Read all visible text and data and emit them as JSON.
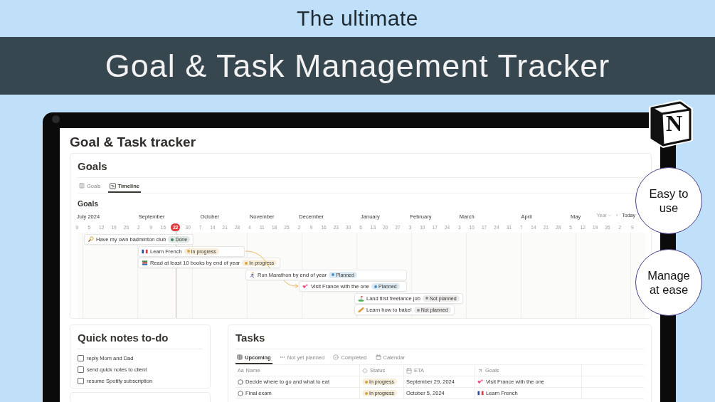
{
  "banner": {
    "kicker": "The ultimate",
    "title": "Goal & Task Management Tracker"
  },
  "logo": {
    "letter": "N"
  },
  "callouts": [
    "Easy to use",
    "Manage at ease"
  ],
  "page": {
    "title": "Goal & Task tracker"
  },
  "goals": {
    "title": "Goals",
    "views": [
      {
        "label": "Goals",
        "selected": false
      },
      {
        "label": "Timeline",
        "selected": true
      }
    ],
    "subtitle": "Goals",
    "timeline": {
      "months": [
        "July 2024",
        "September",
        "October",
        "November",
        "December",
        "January",
        "February",
        "March",
        "April",
        "May"
      ],
      "ticks": [
        {
          "label": "9",
          "selected": false
        },
        {
          "label": "5",
          "selected": false
        },
        {
          "label": "12",
          "selected": false
        },
        {
          "label": "19",
          "selected": false
        },
        {
          "label": "26",
          "selected": false
        },
        {
          "label": "2",
          "selected": false
        },
        {
          "label": "9",
          "selected": false
        },
        {
          "label": "16",
          "selected": false
        },
        {
          "label": "22",
          "selected": true
        },
        {
          "label": "30",
          "selected": false
        },
        {
          "label": "7",
          "selected": false
        },
        {
          "label": "14",
          "selected": false
        },
        {
          "label": "21",
          "selected": false
        },
        {
          "label": "28",
          "selected": false
        },
        {
          "label": "4",
          "selected": false
        },
        {
          "label": "11",
          "selected": false
        },
        {
          "label": "18",
          "selected": false
        },
        {
          "label": "25",
          "selected": false
        },
        {
          "label": "2",
          "selected": false
        },
        {
          "label": "9",
          "selected": false
        },
        {
          "label": "16",
          "selected": false
        },
        {
          "label": "23",
          "selected": false
        },
        {
          "label": "30",
          "selected": false
        },
        {
          "label": "6",
          "selected": false
        },
        {
          "label": "13",
          "selected": false
        },
        {
          "label": "20",
          "selected": false
        },
        {
          "label": "27",
          "selected": false
        },
        {
          "label": "3",
          "selected": false
        },
        {
          "label": "10",
          "selected": false
        },
        {
          "label": "17",
          "selected": false
        },
        {
          "label": "24",
          "selected": false
        },
        {
          "label": "3",
          "selected": false
        },
        {
          "label": "10",
          "selected": false
        },
        {
          "label": "17",
          "selected": false
        },
        {
          "label": "24",
          "selected": false
        },
        {
          "label": "31",
          "selected": false
        },
        {
          "label": "7",
          "selected": false
        },
        {
          "label": "14",
          "selected": false
        },
        {
          "label": "21",
          "selected": false
        },
        {
          "label": "28",
          "selected": false
        },
        {
          "label": "5",
          "selected": false
        },
        {
          "label": "12",
          "selected": false
        },
        {
          "label": "19",
          "selected": false
        },
        {
          "label": "26",
          "selected": false
        },
        {
          "label": "2",
          "selected": false
        },
        {
          "label": "9",
          "selected": false
        }
      ],
      "controls": {
        "scale": "Year",
        "back": "‹",
        "today": "Today"
      }
    },
    "items": [
      {
        "name": "Have my own badminton club",
        "status": "Done",
        "color": "#448361"
      },
      {
        "name": "Learn French",
        "status": "In progress",
        "color": "#d9a23b"
      },
      {
        "name": "Read at least 10 books by end of year",
        "status": "In progress",
        "color": "#d9a23b"
      },
      {
        "name": "Run Marathon by end of year",
        "status": "Planned",
        "color": "#4a8fc9"
      },
      {
        "name": "Visit France with the one",
        "status": "Planned",
        "color": "#4a8fc9"
      },
      {
        "name": "Land first freelance job",
        "status": "Not planned",
        "color": "#91918e"
      },
      {
        "name": "Learn how to bake!",
        "status": "Not planned",
        "color": "#91918e"
      }
    ]
  },
  "notes": {
    "title": "Quick notes to-do",
    "items": [
      {
        "label": "reply Mom and Dad",
        "checked": false
      },
      {
        "label": "send quick notes to client",
        "checked": false
      },
      {
        "label": "resume Spotify subscription",
        "checked": false
      }
    ]
  },
  "tasks": {
    "title": "Tasks",
    "views": [
      {
        "label": "Upcoming",
        "selected": true
      },
      {
        "label": "Not yet planned",
        "selected": false
      },
      {
        "label": "Completed",
        "selected": false
      },
      {
        "label": "Calendar",
        "selected": false
      }
    ],
    "columns": [
      {
        "glyph": "Aa",
        "label": "Name"
      },
      {
        "label": "Status"
      },
      {
        "label": "ETA"
      },
      {
        "label": "Goals"
      }
    ],
    "rows": [
      {
        "name": "Decide where to go and what to eat",
        "status": "In progress",
        "color": "#d9a23b",
        "eta": "September 29, 2024",
        "goal": "Visit France with the one"
      },
      {
        "name": "Final exam",
        "status": "In progress",
        "color": "#d9a23b",
        "eta": "October 5, 2024",
        "goal": "Learn French"
      }
    ]
  }
}
